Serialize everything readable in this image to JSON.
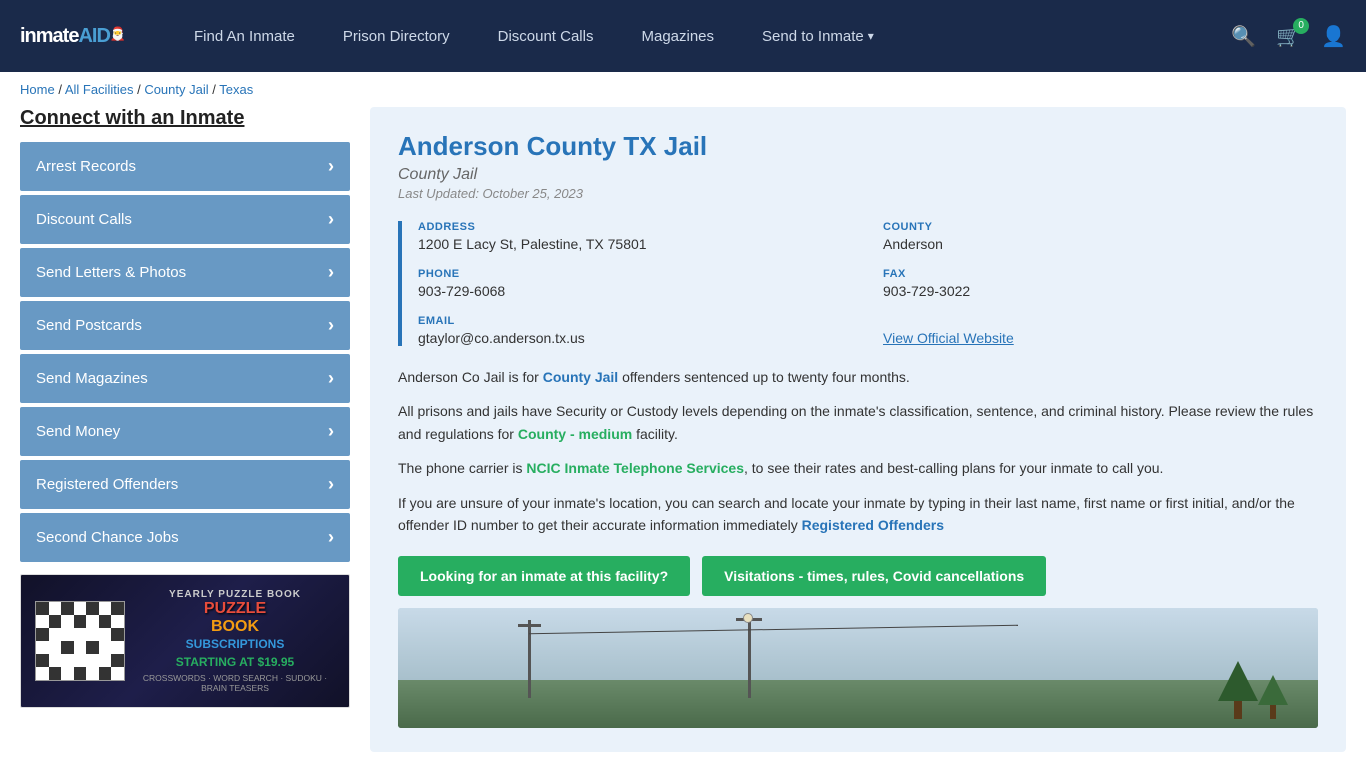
{
  "header": {
    "logo": "inmateAID",
    "nav": [
      {
        "label": "Find An Inmate",
        "id": "find-inmate"
      },
      {
        "label": "Prison Directory",
        "id": "prison-directory"
      },
      {
        "label": "Discount Calls",
        "id": "discount-calls"
      },
      {
        "label": "Magazines",
        "id": "magazines"
      },
      {
        "label": "Send to Inmate",
        "id": "send-to-inmate",
        "arrow": true
      }
    ],
    "cart_count": "0"
  },
  "breadcrumb": {
    "items": [
      "Home",
      "All Facilities",
      "County Jail",
      "Texas"
    ]
  },
  "sidebar": {
    "title": "Connect with an Inmate",
    "items": [
      {
        "label": "Arrest Records",
        "id": "arrest-records"
      },
      {
        "label": "Discount Calls",
        "id": "discount-calls"
      },
      {
        "label": "Send Letters & Photos",
        "id": "send-letters"
      },
      {
        "label": "Send Postcards",
        "id": "send-postcards"
      },
      {
        "label": "Send Magazines",
        "id": "send-magazines"
      },
      {
        "label": "Send Money",
        "id": "send-money"
      },
      {
        "label": "Registered Offenders",
        "id": "registered-offenders"
      },
      {
        "label": "Second Chance Jobs",
        "id": "second-chance-jobs"
      }
    ],
    "ad": {
      "tag": "YEARLY PUZZLE BOOK",
      "title1": "PUZZLE",
      "title2": "BOOK",
      "subtitle": "SUBSCRIPTIONS",
      "price": "STARTING AT $19.95",
      "types": "CROSSWORDS · WORD SEARCH · SUDOKU · BRAIN TEASERS"
    }
  },
  "facility": {
    "title": "Anderson County TX Jail",
    "type": "County Jail",
    "updated": "Last Updated: October 25, 2023",
    "address_label": "ADDRESS",
    "address_value": "1200 E Lacy St, Palestine, TX 75801",
    "county_label": "COUNTY",
    "county_value": "Anderson",
    "phone_label": "PHONE",
    "phone_value": "903-729-6068",
    "fax_label": "FAX",
    "fax_value": "903-729-3022",
    "email_label": "EMAIL",
    "email_value": "gtaylor@co.anderson.tx.us",
    "website_label": "View Official Website",
    "desc1": "Anderson Co Jail is for ",
    "desc1_link": "County Jail",
    "desc1_end": " offenders sentenced up to twenty four months.",
    "desc2": "All prisons and jails have Security or Custody levels depending on the inmate's classification, sentence, and criminal history. Please review the rules and regulations for ",
    "desc2_link": "County - medium",
    "desc2_end": " facility.",
    "desc3": "The phone carrier is ",
    "desc3_link": "NCIC Inmate Telephone Services",
    "desc3_end": ", to see their rates and best-calling plans for your inmate to call you.",
    "desc4": "If you are unsure of your inmate's location, you can search and locate your inmate by typing in their last name, first name or first initial, and/or the offender ID number to get their accurate information immediately ",
    "desc4_link": "Registered Offenders",
    "btn1": "Looking for an inmate at this facility?",
    "btn2": "Visitations - times, rules, Covid cancellations"
  }
}
